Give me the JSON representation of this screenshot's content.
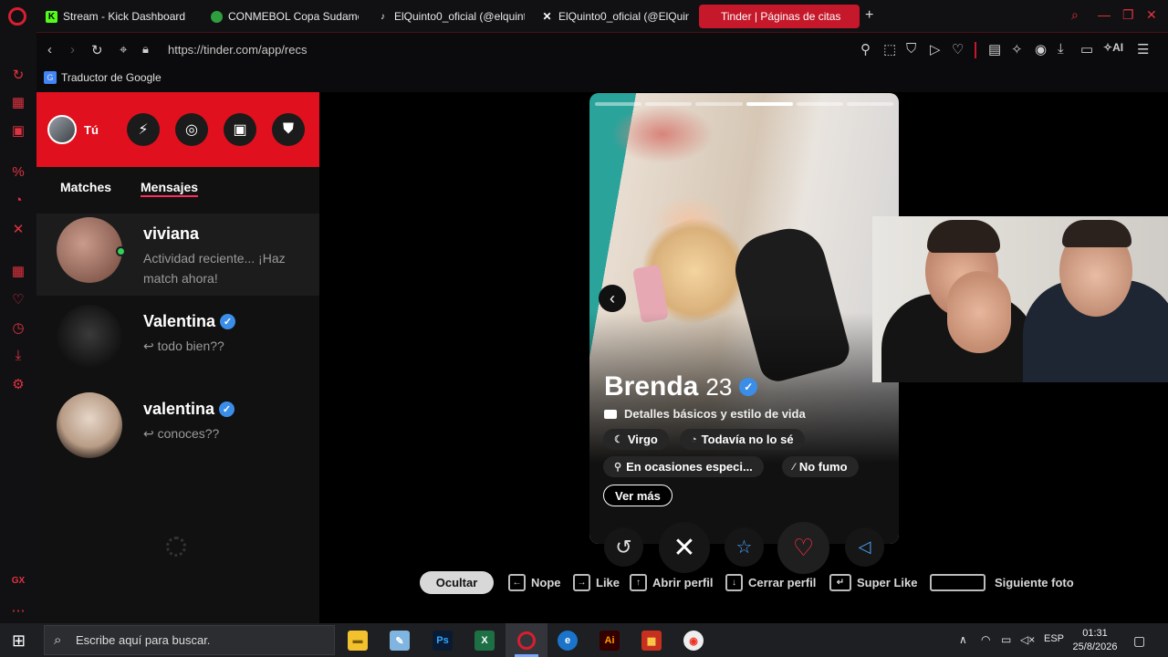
{
  "browser": {
    "tabs": [
      {
        "label": "Stream - Kick Dashboard",
        "icon": "kick-icon",
        "color": "#53fc18"
      },
      {
        "label": "CONMEBOL Copa Sudame",
        "icon": "conmebol-icon",
        "color": "#2e9e3e"
      },
      {
        "label": "ElQuinto0_oficial (@elquint",
        "icon": "tiktok-icon",
        "color": "#ffffff"
      },
      {
        "label": "ElQuinto0_oficial (@ElQuint",
        "icon": "x-icon",
        "color": "#ffffff"
      },
      {
        "label": "Tinder | Páginas de citas",
        "icon": "tinder-icon",
        "color": "#ff4458"
      }
    ],
    "new_tab": "+",
    "url": "https://tinder.com/app/recs",
    "ai_label": "AI",
    "bookmark": "Traductor de Google"
  },
  "left_panel": {
    "me_label": "Tú",
    "tabs": [
      "Matches",
      "Mensajes"
    ],
    "active_tab": "Mensajes",
    "conversations": [
      {
        "name": "viviana",
        "message": "Actividad reciente... ¡Haz match ahora!",
        "verified": false,
        "online": true
      },
      {
        "name": "Valentina",
        "message": "↩ todo bien??",
        "verified": true,
        "online": false
      },
      {
        "name": "valentina",
        "message": "↩ conoces??",
        "verified": true,
        "online": false
      }
    ]
  },
  "profile": {
    "name": "Brenda",
    "age": "23",
    "photo_index": 4,
    "photo_count": 6,
    "details_label": "Detalles básicos y estilo de vida",
    "chips": [
      {
        "icon": "moon-icon",
        "label": "Virgo"
      },
      {
        "icon": "baby-icon",
        "label": "Todavía no lo sé"
      },
      {
        "icon": "glass-icon",
        "label": "En ocasiones especi..."
      },
      {
        "icon": "smoke-icon",
        "label": "No fumo"
      }
    ],
    "ver_mas": "Ver más"
  },
  "shortcuts": {
    "hide": "Ocultar",
    "items": [
      {
        "key": "←",
        "label": "Nope"
      },
      {
        "key": "→",
        "label": "Like"
      },
      {
        "key": "↑",
        "label": "Abrir perfil"
      },
      {
        "key": "↓",
        "label": "Cerrar perfil"
      },
      {
        "key": "↵",
        "label": "Super Like"
      },
      {
        "key": "",
        "label": "Siguiente foto"
      }
    ]
  },
  "taskbar": {
    "search_placeholder": "Escribe aquí para buscar.",
    "language": "ESP",
    "time": "01:31",
    "date": "25/8/2026"
  },
  "colors": {
    "tinder_red": "#e0101e",
    "accent_pink": "#fd2e5d",
    "verified_blue": "#3b8ee8",
    "online_green": "#34d058"
  }
}
